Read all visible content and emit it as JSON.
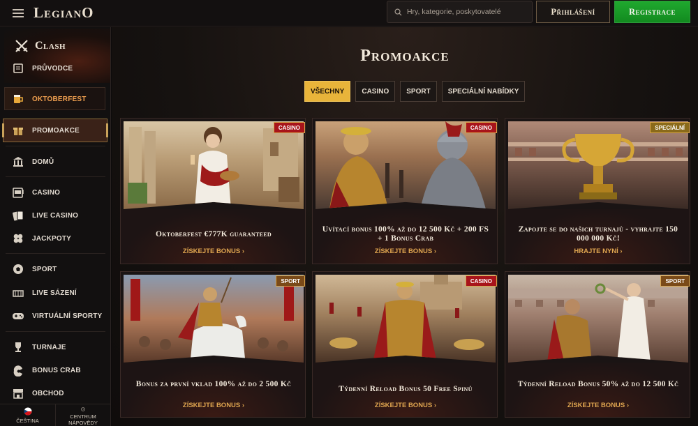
{
  "header": {
    "logo": "LegianO",
    "search_placeholder": "Hry, kategorie, poskytovatelé",
    "login_label": "Přihlášení",
    "register_label": "Registrace"
  },
  "sidebar": {
    "clash": "Clash",
    "guide": "Průvodce",
    "items": [
      {
        "label": "Oktoberfest",
        "icon": "beer-mug-icon"
      },
      {
        "label": "Promoakce",
        "icon": "gift-icon"
      },
      {
        "label": "Domů",
        "icon": "temple-icon"
      },
      {
        "label": "Casino",
        "icon": "slot-machine-icon"
      },
      {
        "label": "Live casino",
        "icon": "cards-icon"
      },
      {
        "label": "Jackpoty",
        "icon": "clover-icon"
      },
      {
        "label": "Sport",
        "icon": "ball-icon"
      },
      {
        "label": "Live sázení",
        "icon": "stadium-icon"
      },
      {
        "label": "Virtuální sporty",
        "icon": "gamepad-icon"
      },
      {
        "label": "Turnaje",
        "icon": "trophy-icon"
      },
      {
        "label": "Bonus Crab",
        "icon": "claw-icon"
      },
      {
        "label": "Obchod",
        "icon": "shop-icon"
      }
    ],
    "language": "Čeština",
    "help": "Centrum nápovědy"
  },
  "main": {
    "title": "Promoakce",
    "filters": [
      "Všechny",
      "Casino",
      "Sport",
      "Speciální nabídky"
    ],
    "cards": [
      {
        "badge": "CASINO",
        "title": "Oktoberfest €777K guaranteed",
        "cta": "Získejte bonus"
      },
      {
        "badge": "CASINO",
        "title": "Uvítací bonus 100% až do 12 500 Kč + 200 FS + 1 Bonus Crab",
        "cta": "Získejte bonus"
      },
      {
        "badge": "SPECIÁLNÍ",
        "title": "Zapojte se do našich turnajů - vyhrajte 150 000 000 Kč!",
        "cta": "Hrajte nyní"
      },
      {
        "badge": "SPORT",
        "title": "Bonus za první vklad 100% až do 2 500 Kč",
        "cta": "Získejte bonus"
      },
      {
        "badge": "CASINO",
        "title": "Týdenní Reload Bonus 50 Free Spinů",
        "cta": "Získejte bonus"
      },
      {
        "badge": "SPORT",
        "title": "Týdenní Reload Bonus 50% až do 12 500 Kč",
        "cta": "Získejte bonus"
      }
    ]
  },
  "colors": {
    "accent_gold": "#e8b43a",
    "register_green": "#20a92f",
    "casino_badge": "#a8141a",
    "sport_badge": "#7a4a18",
    "cta": "#e0a650"
  }
}
